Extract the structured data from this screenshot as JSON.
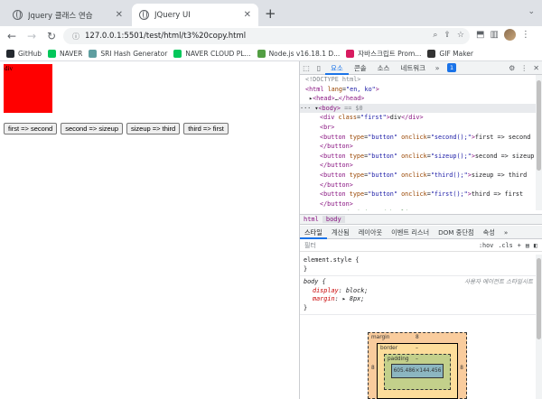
{
  "tabs": [
    {
      "title": "Jquery 클래스 연습",
      "active": false
    },
    {
      "title": "JQuery UI",
      "active": true
    }
  ],
  "toolbar": {
    "url": "127.0.0.1:5501/test/html/t3%20copy.html"
  },
  "bookmarks": [
    {
      "label": "GitHub",
      "color": "#24292f"
    },
    {
      "label": "NAVER",
      "color": "#03c75a"
    },
    {
      "label": "SRI Hash Generator",
      "color": "#5f9ea0"
    },
    {
      "label": "NAVER CLOUD PL...",
      "color": "#03c75a"
    },
    {
      "label": "Node.js v16.18.1 D...",
      "color": "#539e43"
    },
    {
      "label": "자바스크립트 Prom...",
      "color": "#d81b60"
    },
    {
      "label": "GIF Maker",
      "color": "#333333"
    }
  ],
  "page": {
    "div_text": "div",
    "buttons": [
      "first => second",
      "second => sizeup",
      "sizeup => third",
      "third => first"
    ]
  },
  "devtools": {
    "tabs": [
      "요소",
      "콘솔",
      "소스",
      "네트워크"
    ],
    "badge": "1",
    "code_lines": [
      {
        "html": "<span class=\"gray\">&lt;!DOCTYPE html&gt;</span>",
        "indent": 6
      },
      {
        "html": "<span class=\"tag\">&lt;html</span> <span class=\"attr\">lang</span>=<span class=\"val\">\"en, ko\"</span><span class=\"tag\">&gt;</span>",
        "indent": 6
      },
      {
        "html": "▸<span class=\"tag\">&lt;head&gt;</span>…<span class=\"tag\">&lt;/head&gt;</span>",
        "indent": 10
      },
      {
        "html": "··· ▾<span class=\"tag\">&lt;body&gt;</span> <span class=\"gray\">== $0</span>",
        "indent": 0,
        "selected": true
      },
      {
        "html": "<span class=\"tag\">&lt;div</span> <span class=\"attr\">class</span>=<span class=\"val\">\"first\"</span><span class=\"tag\">&gt;</span>div<span class=\"tag\">&lt;/div&gt;</span>",
        "indent": 22
      },
      {
        "html": "<span class=\"tag\">&lt;br&gt;</span>",
        "indent": 22
      },
      {
        "html": "<span class=\"tag\">&lt;button</span> <span class=\"attr\">type</span>=<span class=\"val\">\"button\"</span> <span class=\"attr\">onclick</span>=<span class=\"val\">\"second();\"</span><span class=\"tag\">&gt;</span>first =&gt; second",
        "indent": 22
      },
      {
        "html": "<span class=\"tag\">&lt;/button&gt;</span>",
        "indent": 22
      },
      {
        "html": "<span class=\"tag\">&lt;button</span> <span class=\"attr\">type</span>=<span class=\"val\">\"button\"</span> <span class=\"attr\">onclick</span>=<span class=\"val\">\"sizeup();\"</span><span class=\"tag\">&gt;</span>second =&gt; sizeup",
        "indent": 22
      },
      {
        "html": "<span class=\"tag\">&lt;/button&gt;</span>",
        "indent": 22
      },
      {
        "html": "<span class=\"tag\">&lt;button</span> <span class=\"attr\">type</span>=<span class=\"val\">\"button\"</span> <span class=\"attr\">onclick</span>=<span class=\"val\">\"third();\"</span><span class=\"tag\">&gt;</span>sizeup =&gt; third",
        "indent": 22
      },
      {
        "html": "<span class=\"tag\">&lt;/button&gt;</span>",
        "indent": 22
      },
      {
        "html": "<span class=\"tag\">&lt;button</span> <span class=\"attr\">type</span>=<span class=\"val\">\"button\"</span> <span class=\"attr\">onclick</span>=<span class=\"val\">\"first();\"</span><span class=\"tag\">&gt;</span>third =&gt; first",
        "indent": 22
      },
      {
        "html": "<span class=\"tag\">&lt;/button&gt;</span>",
        "indent": 22
      },
      {
        "html": "<span class=\"cmt\">&lt;!-- Code injected by live-server --&gt;</span>",
        "indent": 22
      }
    ],
    "crumbs": [
      "html",
      "body"
    ],
    "style_tabs": [
      "스타일",
      "계산됨",
      "레이아웃",
      "이벤트 리스너",
      "DOM 중단점",
      "속성"
    ],
    "filter_placeholder": "필터",
    "filter_tools": [
      ":hov",
      ".cls",
      "+"
    ],
    "rule1_selector": "element.style {",
    "rule1_close": "}",
    "rule2_selector": "body {",
    "rule2_source": "사용자 에이전트 스타일시트",
    "rule2_prop1": "display",
    "rule2_val1": "block;",
    "rule2_prop2": "margin",
    "rule2_val2": "▸ 8px;",
    "rule2_close": "}",
    "box": {
      "margin_label": "margin",
      "margin_top": "8",
      "margin_side_l": "8",
      "margin_side_r": "8",
      "border_label": "border",
      "border_val": "–",
      "padding_label": "padding",
      "padding_val": "–",
      "content": "605.486×144.456"
    }
  }
}
